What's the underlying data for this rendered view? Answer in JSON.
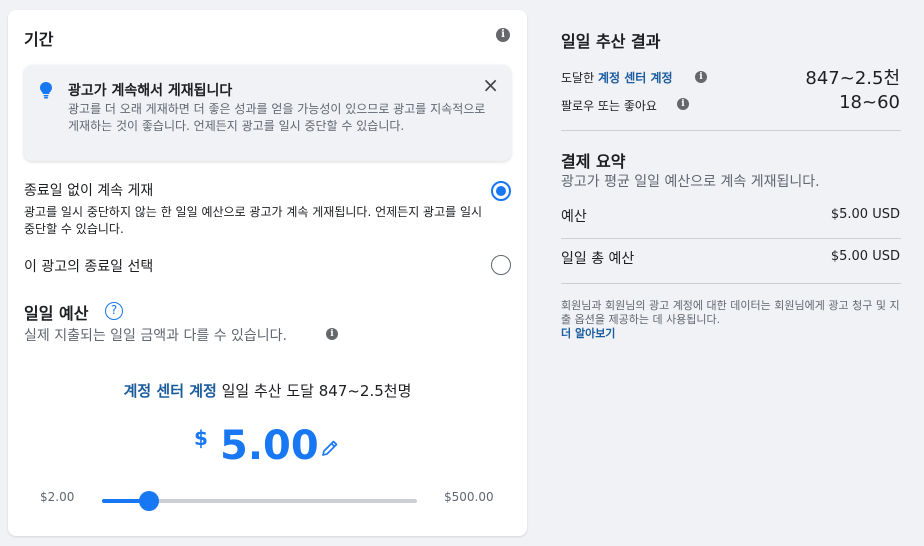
{
  "duration": {
    "title": "기간",
    "notice": {
      "title": "광고가 계속해서 게재됩니다",
      "body": "광고를 더 오래 게재하면 더 좋은 성과를 얻을 가능성이 있으므로 광고를 지속적으로 게재하는 것이 좋습니다. 언제든지 광고를 일시 중단할 수 있습니다.",
      "close": "×"
    },
    "options": [
      {
        "label": "종료일 없이 계속 게재",
        "description": "광고를 일시 중단하지 않는 한 일일 예산으로 광고가 계속 게재됩니다. 언제든지 광고를 일시 중단할 수 있습니다.",
        "selected": true
      },
      {
        "label": "이 광고의 종료일 선택",
        "selected": false
      }
    ]
  },
  "budget": {
    "title": "일일 예산",
    "help": "?",
    "subtitle": "실제 지출되는 일일 금액과 다를 수 있습니다.",
    "reach_link": "계정 센터 계정",
    "reach_text": "일일 추산 도달 847~2.5천명",
    "currency": "$",
    "amount": "5.00",
    "slider_min": "$2.00",
    "slider_max": "$500.00",
    "slider_fraction": 0.15
  },
  "results": {
    "title": "일일 추산 결과",
    "reach_prefix": "도달한",
    "reach_link": "계정 센터 계정",
    "reach_value": "847~2.5천",
    "followers_label": "팔로우 또는 좋아요",
    "followers_value": "18~60"
  },
  "payment": {
    "title": "결제 요약",
    "subtitle": "광고가 평균 일일 예산으로 계속 게재됩니다.",
    "budget_label": "예산",
    "budget_value": "$5.00 USD",
    "total_label": "일일 총 예산",
    "total_value": "$5.00 USD",
    "footnote": "회원님과 회원님의 광고 계정에 대한 데이터는 회원님에게 광고 청구 및 지출 옵션을 제공하는 데 사용됩니다.",
    "learn_more": "더 알아보기"
  },
  "colors": {
    "accent": "#1877f2",
    "link": "#1b5c9e",
    "muted": "#606770"
  },
  "icons": {
    "info": "info-icon",
    "bulb": "lightbulb-icon",
    "close": "close-icon",
    "pencil": "pencil-icon",
    "help": "question-icon"
  }
}
